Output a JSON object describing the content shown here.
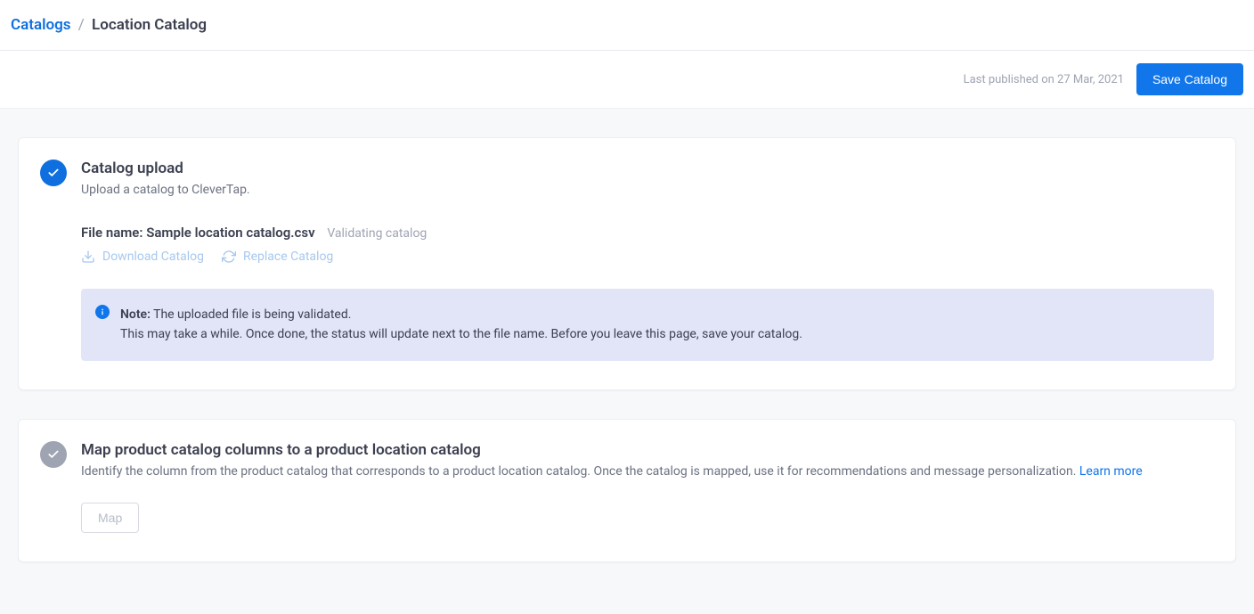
{
  "breadcrumb": {
    "root": "Catalogs",
    "sep": "/",
    "current": "Location Catalog"
  },
  "toolbar": {
    "last_published": "Last published on 27 Mar, 2021",
    "save_label": "Save Catalog"
  },
  "step_upload": {
    "title": "Catalog upload",
    "subtitle": "Upload a catalog to CleverTap.",
    "file_label": "File name: ",
    "file_name": "Sample location catalog.csv",
    "file_status": "Validating catalog",
    "action_download": "Download Catalog",
    "action_replace": "Replace Catalog",
    "note_strong": "Note:",
    "note_line1": " The uploaded file is being validated.",
    "note_line2": "This may take a while. Once done, the status will update next to the file name. Before you leave this page, save your catalog."
  },
  "step_map": {
    "title": "Map product catalog columns to a product location catalog",
    "subtitle_a": "Identify the column from the product catalog that corresponds to a product location catalog. Once the catalog is mapped, use it for recommendations and message personalization. ",
    "learn_more": "Learn more",
    "button": "Map"
  }
}
